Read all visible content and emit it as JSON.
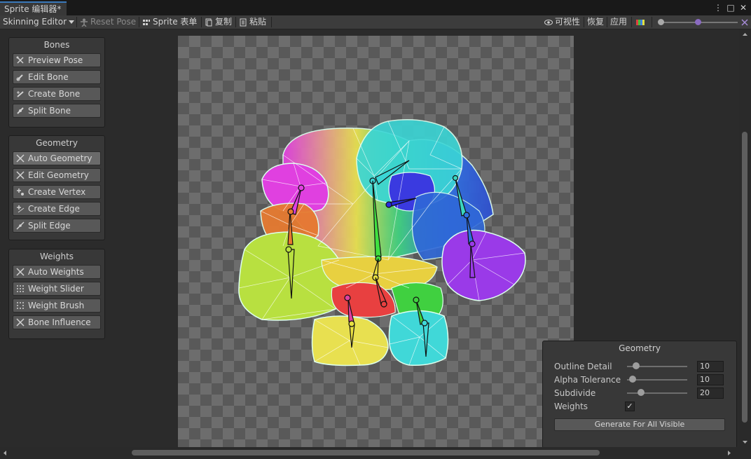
{
  "tab": {
    "title": "Sprite 编辑器*"
  },
  "window_controls": {
    "menu": "⋮",
    "maximize": "□",
    "close": "✕"
  },
  "toolbar": {
    "mode_label": "Skinning Editor",
    "reset_pose": "Reset Pose",
    "sprite_table": "Sprite 表单",
    "copy": "复制",
    "paste": "粘贴",
    "visibility": "可视性",
    "revert": "恢复",
    "apply": "应用"
  },
  "panels": {
    "bones": {
      "title": "Bones",
      "items": [
        "Preview Pose",
        "Edit Bone",
        "Create Bone",
        "Split Bone"
      ]
    },
    "geometry": {
      "title": "Geometry",
      "items": [
        "Auto Geometry",
        "Edit Geometry",
        "Create Vertex",
        "Create Edge",
        "Split Edge"
      ]
    },
    "weights": {
      "title": "Weights",
      "items": [
        "Auto Weights",
        "Weight Slider",
        "Weight Brush",
        "Bone Influence"
      ]
    }
  },
  "geometry_settings": {
    "title": "Geometry",
    "outline_detail_label": "Outline Detail",
    "outline_detail_value": "10",
    "alpha_tolerance_label": "Alpha Tolerance",
    "alpha_tolerance_value": "10",
    "subdivide_label": "Subdivide",
    "subdivide_value": "20",
    "weights_label": "Weights",
    "weights_checked": "✓",
    "generate_button": "Generate For All Visible"
  },
  "colors": {
    "accent": "#3a79bb",
    "canvas_light": "#6d6d6d",
    "canvas_dark": "#595959"
  }
}
